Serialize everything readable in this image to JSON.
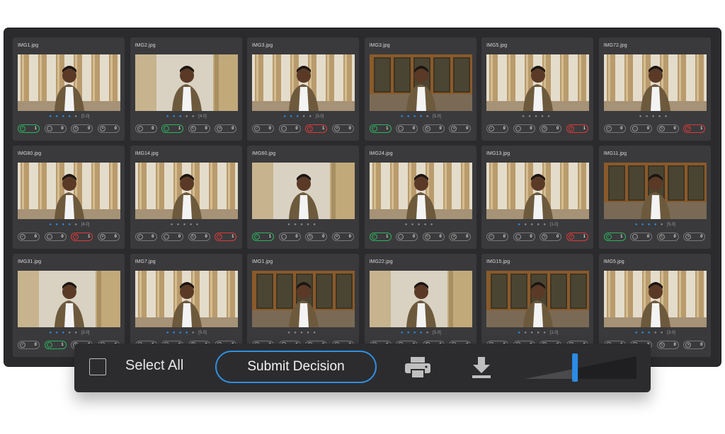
{
  "photos": [
    {
      "file": "IMG1.jpg",
      "stars": 4,
      "rating": "[5.0]",
      "counts": [
        "1",
        "0",
        "0",
        "0"
      ],
      "states": [
        "green",
        "",
        "",
        ""
      ],
      "scene": "columns",
      "frame": false
    },
    {
      "file": "IMG2.jpg",
      "stars": 3,
      "rating": "[4.0]",
      "counts": [
        "0",
        "1",
        "0",
        "0"
      ],
      "states": [
        "",
        "green",
        "",
        ""
      ],
      "scene": "closeup",
      "frame": false
    },
    {
      "file": "IMG3.jpg",
      "stars": 3,
      "rating": "[3.0]",
      "counts": [
        "0",
        "0",
        "1",
        "0"
      ],
      "states": [
        "",
        "",
        "red",
        ""
      ],
      "scene": "columns",
      "frame": false
    },
    {
      "file": "IMG3.jpg",
      "stars": 4,
      "rating": "[5.0]",
      "counts": [
        "1",
        "0",
        "0",
        "0"
      ],
      "states": [
        "green",
        "",
        "",
        ""
      ],
      "scene": "window",
      "frame": true
    },
    {
      "file": "IMG5.jpg",
      "stars": 0,
      "rating": "",
      "counts": [
        "0",
        "0",
        "0",
        "1"
      ],
      "states": [
        "",
        "",
        "",
        "red"
      ],
      "scene": "columns",
      "frame": false
    },
    {
      "file": "IMG72.jpg",
      "stars": 0,
      "rating": "",
      "counts": [
        "0",
        "0",
        "0",
        "1"
      ],
      "states": [
        "",
        "",
        "",
        "red"
      ],
      "scene": "columns",
      "frame": false
    },
    {
      "file": "IMG80.jpg",
      "stars": 4,
      "rating": "[4.0]",
      "counts": [
        "0",
        "0",
        "1",
        "0"
      ],
      "states": [
        "",
        "",
        "red",
        ""
      ],
      "scene": "columns",
      "frame": false
    },
    {
      "file": "IMG14.jpg",
      "stars": 0,
      "rating": "",
      "counts": [
        "0",
        "0",
        "0",
        "1"
      ],
      "states": [
        "",
        "",
        "",
        "red"
      ],
      "scene": "columns",
      "frame": false
    },
    {
      "file": "IMG60.jpg",
      "stars": 0,
      "rating": "",
      "counts": [
        "1",
        "0",
        "0",
        "0"
      ],
      "states": [
        "green",
        "",
        "",
        ""
      ],
      "scene": "closeup",
      "frame": false
    },
    {
      "file": "IMG24.jpg",
      "stars": 0,
      "rating": "",
      "counts": [
        "1",
        "0",
        "0",
        "0"
      ],
      "states": [
        "green",
        "",
        "",
        ""
      ],
      "scene": "columns",
      "frame": false
    },
    {
      "file": "IMG13.jpg",
      "stars": 1,
      "rating": "[1.0]",
      "counts": [
        "0",
        "0",
        "0",
        "1"
      ],
      "states": [
        "",
        "",
        "",
        "red"
      ],
      "scene": "columns",
      "frame": false
    },
    {
      "file": "IMG11.jpg",
      "stars": 4,
      "rating": "[5.0]",
      "counts": [
        "1",
        "0",
        "0",
        "0"
      ],
      "states": [
        "green",
        "",
        "",
        ""
      ],
      "scene": "window",
      "frame": true
    },
    {
      "file": "IMG31.jpg",
      "stars": 3,
      "rating": "[3.0]",
      "counts": [
        "0",
        "1",
        "0",
        "0"
      ],
      "states": [
        "",
        "green",
        "",
        ""
      ],
      "scene": "closeup",
      "frame": false
    },
    {
      "file": "IMG7.jpg",
      "stars": 4,
      "rating": "[5.0]",
      "counts": [
        "0",
        "0",
        "0",
        "0"
      ],
      "states": [
        "",
        "",
        "",
        ""
      ],
      "scene": "columns",
      "frame": false
    },
    {
      "file": "IMG1.jpg",
      "stars": 0,
      "rating": "",
      "counts": [
        "0",
        "0",
        "0",
        "0"
      ],
      "states": [
        "",
        "",
        "",
        ""
      ],
      "scene": "window",
      "frame": true
    },
    {
      "file": "IMG22.jpg",
      "stars": 4,
      "rating": "[5.0]",
      "counts": [
        "0",
        "0",
        "0",
        "0"
      ],
      "states": [
        "",
        "",
        "",
        ""
      ],
      "scene": "closeup",
      "frame": false
    },
    {
      "file": "IMG15.jpg",
      "stars": 1,
      "rating": "[1.0]",
      "counts": [
        "0",
        "0",
        "0",
        "0"
      ],
      "states": [
        "",
        "",
        "",
        ""
      ],
      "scene": "window",
      "frame": true
    },
    {
      "file": "IMG5.jpg",
      "stars": 3,
      "rating": "[3.0]",
      "counts": [
        "0",
        "0",
        "0",
        "0"
      ],
      "states": [
        "",
        "",
        "",
        ""
      ],
      "scene": "columns",
      "frame": false
    }
  ],
  "toolbar": {
    "select_all_label": "Select All",
    "submit_label": "Submit Decision",
    "print_icon": "print-icon",
    "download_icon": "download-icon",
    "zoom_level": 0.45
  },
  "colors": {
    "accent": "#2b8ce6",
    "approve": "#2db35d",
    "reject": "#d93a3a",
    "panel": "#2b2b2d",
    "card": "#3a3a3c"
  },
  "icons": [
    "check-circle-icon",
    "chat-bubble-icon",
    "rotate-icon",
    "x-circle-icon",
    "star-icon"
  ]
}
